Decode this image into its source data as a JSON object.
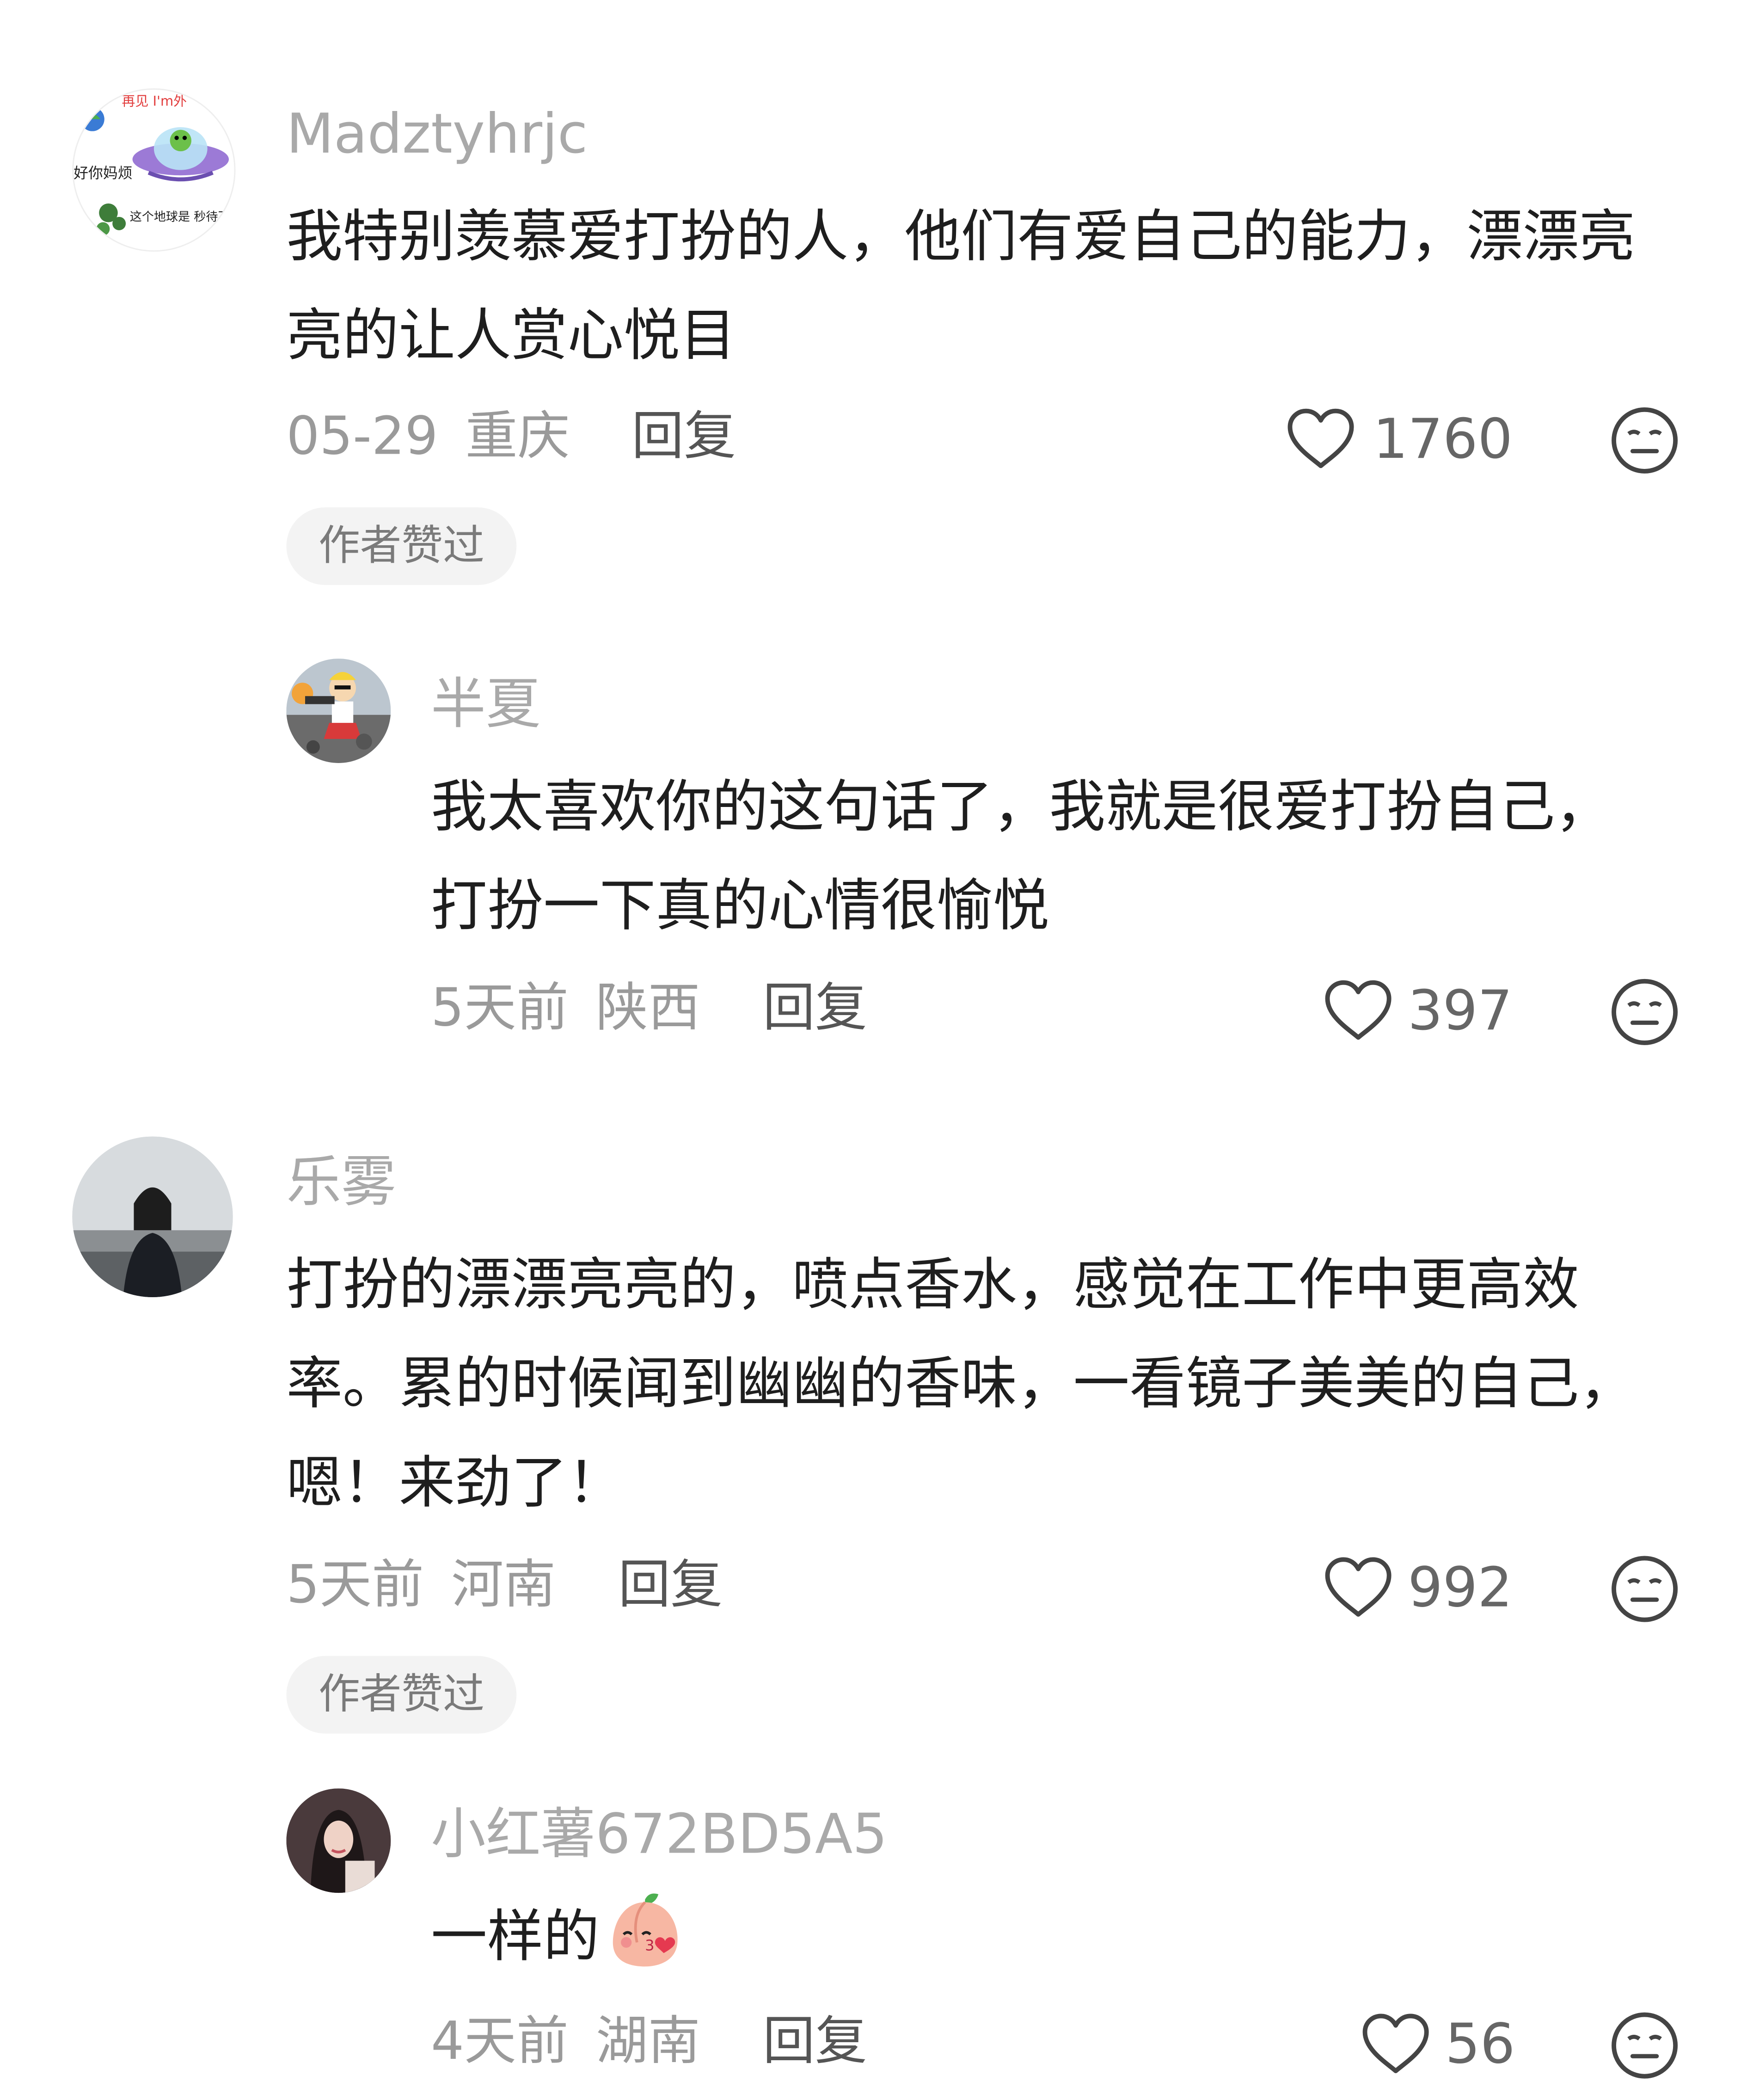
{
  "comments": [
    {
      "username": "Madztyhrjc",
      "avatar_text": {
        "top": "再见 I'm外",
        "mid": "好你妈烦",
        "bottom": "这个地球是 秒待不下"
      },
      "text": "我特别羡慕爱打扮的人，他们有爱自己的能力，漂漂亮亮的让人赏心悦目",
      "date": "05-29",
      "location": "重庆",
      "reply_label": "回复",
      "likes": "1760",
      "author_liked_label": "作者赞过",
      "reply": {
        "username": "半夏",
        "text": "我太喜欢你的这句话了，我就是很爱打扮自己，打扮一下真的心情很愉悦",
        "date": "5天前",
        "location": "陕西",
        "reply_label": "回复",
        "likes": "397"
      }
    },
    {
      "username": "乐雾",
      "text": "打扮的漂漂亮亮的，喷点香水，感觉在工作中更高效率。累的时候闻到幽幽的香味，一看镜子美美的自己，嗯！来劲了！",
      "date": "5天前",
      "location": "河南",
      "reply_label": "回复",
      "likes": "992",
      "author_liked_label": "作者赞过",
      "reply": {
        "username": "小红薯672BD5A5",
        "text": "一样的",
        "date": "4天前",
        "location": "湖南",
        "reply_label": "回复",
        "likes": "56"
      }
    }
  ],
  "icons": {
    "like": "heart-outline-icon",
    "dislike": "neutral-face-icon",
    "emoji": "peach-kiss-emoji"
  },
  "colors": {
    "username": "#a9a9a9",
    "text": "#1e1e1e",
    "meta": "#9a9a9a",
    "chip_bg": "#f3f3f3"
  }
}
